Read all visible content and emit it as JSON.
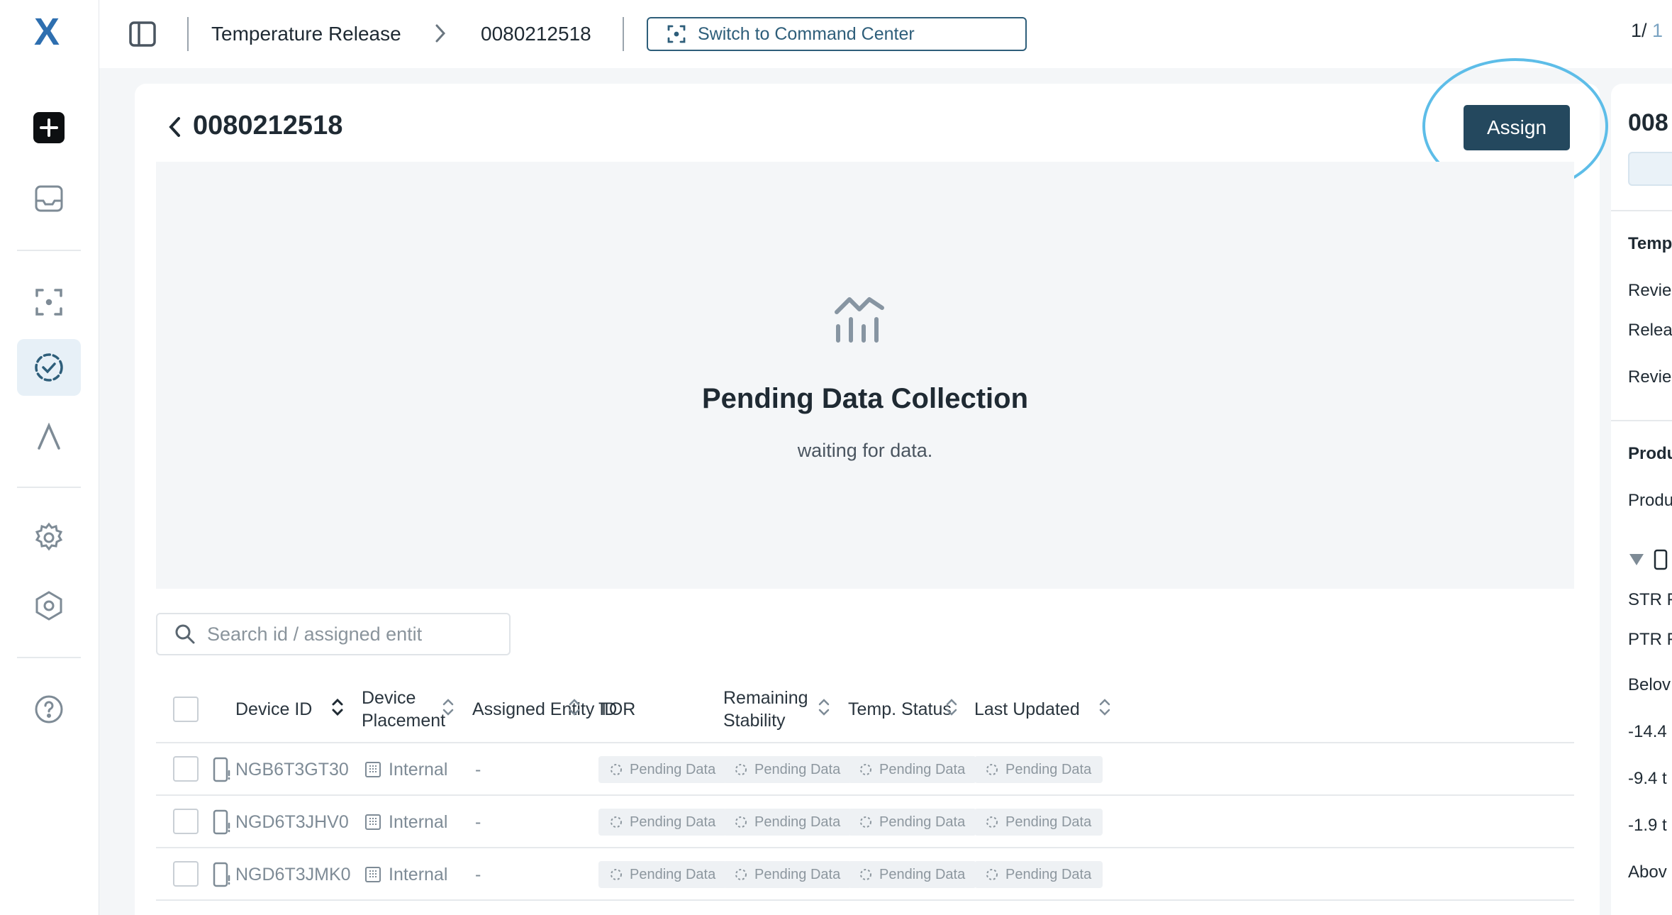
{
  "app": {
    "logo_text": "X"
  },
  "breadcrumb": {
    "items": [
      "Temperature Release",
      "0080212518"
    ],
    "command_center_label": "Switch to Command Center"
  },
  "pager": {
    "current": "1/",
    "total": " 1"
  },
  "sidebar": {
    "icons": [
      "add-icon",
      "inbox-icon",
      "focus-icon",
      "check-circle-icon",
      "lambda-icon",
      "gear-icon",
      "shield-hex-icon",
      "help-icon"
    ]
  },
  "card": {
    "title": "0080212518",
    "assign_label": "Assign"
  },
  "empty_state": {
    "title": "Pending Data Collection",
    "subtitle": "waiting for data."
  },
  "search": {
    "placeholder": "Search id / assigned entit"
  },
  "table": {
    "headers": {
      "device_id": "Device ID",
      "device_placement_1": "Device",
      "device_placement_2": "Placement",
      "assigned_entity": "Assigned Entity ID",
      "tor": "TOR",
      "remaining_1": "Remaining",
      "remaining_2": "Stability",
      "temp_status": "Temp. Status",
      "last_updated": "Last Updated"
    },
    "rows": [
      {
        "device_id": "NGB6T3GT30",
        "placement": "Internal",
        "entity": "-",
        "tor": "Pending Data",
        "stability": "Pending Data",
        "status": "Pending Data",
        "updated": "Pending Data"
      },
      {
        "device_id": "NGD6T3JHV0",
        "placement": "Internal",
        "entity": "-",
        "tor": "Pending Data",
        "stability": "Pending Data",
        "status": "Pending Data",
        "updated": "Pending Data"
      },
      {
        "device_id": "NGD6T3JMK0",
        "placement": "Internal",
        "entity": "-",
        "tor": "Pending Data",
        "stability": "Pending Data",
        "status": "Pending Data",
        "updated": "Pending Data"
      }
    ]
  },
  "right_panel": {
    "title": "008",
    "section1_title": "Temp",
    "lines1": [
      "Revie",
      "Relea",
      "Revie"
    ],
    "section2_title": "Produ",
    "line2": "Produ",
    "lines3": [
      "STR F",
      "PTR F",
      "Belov",
      "-14.4",
      "-9.4 t",
      "-1.9 t",
      "Abov"
    ]
  },
  "colors": {
    "primary": "#24485e",
    "accent": "#2e5e7a",
    "highlight": "#5dbde8"
  }
}
